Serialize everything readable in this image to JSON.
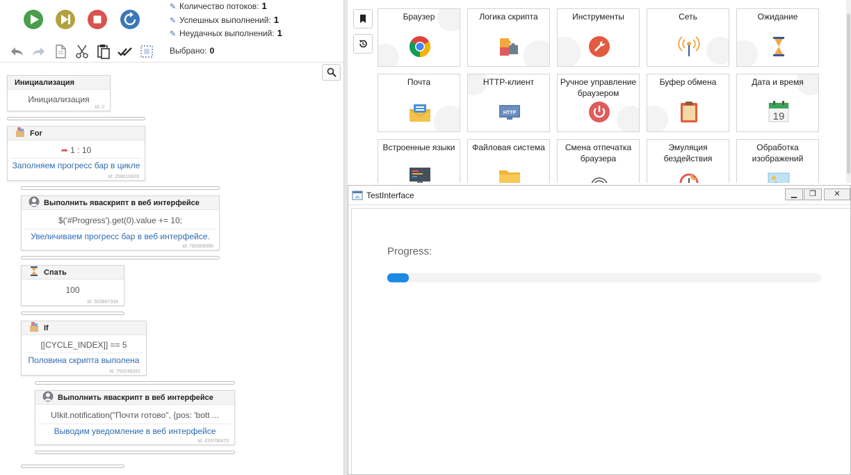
{
  "stats": {
    "threads_label": "Количество потоков:",
    "threads_value": "1",
    "success_label": "Успешных выполнений:",
    "success_value": "1",
    "fail_label": "Неудачных выполнений:",
    "fail_value": "1"
  },
  "toolbar": {
    "selected_label": "Выбрано:",
    "selected_value": "0"
  },
  "blocks": [
    {
      "title": "Инициализация",
      "body": "Инициализация",
      "comment": "",
      "id": "Id: 0"
    },
    {
      "title": "For",
      "body": "1 : 10",
      "comment": "Заполняем прогресс бар в цикле",
      "id": "Id: 259616603"
    },
    {
      "title": "Выполнить яваскрипт в веб интерфейсе",
      "body": "$('#Progress').get(0).value += 10;",
      "comment": "Увеличиваем прогресс бар в веб интерфейсе.",
      "id": "Id: 785309586"
    },
    {
      "title": "Спать",
      "body": "100",
      "comment": "",
      "id": "Id: 503697334"
    },
    {
      "title": "If",
      "body": "[[CYCLE_INDEX]] == 5",
      "comment": "Половина скрипта выполена",
      "id": "Id: 750248281"
    },
    {
      "title": "Выполнить яваскрипт в веб интерфейсе",
      "body": "UIkit.notification(\"Почти готово\", {pos: 'bott ...",
      "comment": "Выводим уведомление в веб интерфейсе",
      "id": "Id: 433706470"
    }
  ],
  "palette": [
    {
      "label": "Браузер",
      "icon": "chrome-icon"
    },
    {
      "label": "Логика скрипта",
      "icon": "puzzle-icon"
    },
    {
      "label": "Инструменты",
      "icon": "wrench-icon"
    },
    {
      "label": "Сеть",
      "icon": "antenna-icon"
    },
    {
      "label": "Ожидание",
      "icon": "hourglass-icon"
    },
    {
      "label": "Почта",
      "icon": "mail-icon"
    },
    {
      "label": "HTTP-клиент",
      "icon": "http-icon"
    },
    {
      "label": "Ручное управление браузером",
      "icon": "power-icon"
    },
    {
      "label": "Буфер обмена",
      "icon": "clipboard-icon"
    },
    {
      "label": "Дата и время",
      "icon": "calendar-icon"
    },
    {
      "label": "Встроенные языки",
      "icon": "code-monitor-icon"
    },
    {
      "label": "Файловая система",
      "icon": "folder-icon"
    },
    {
      "label": "Смена отпечатка браузера",
      "icon": "fingerprint-icon"
    },
    {
      "label": "Эмуляция бездействия",
      "icon": "alarm-icon"
    },
    {
      "label": "Обработка изображений",
      "icon": "image-icon"
    }
  ],
  "calendar_day": "19",
  "http_text": "HTTP",
  "window": {
    "title": "TestInterface",
    "progress_label": "Progress:",
    "progress_value": 0.05
  },
  "colors": {
    "play": "#4a9d4a",
    "skip": "#b2a23f",
    "stop": "#d9534f",
    "refresh": "#3a78b8",
    "comment": "#2d6bb3",
    "progress": "#1e88e5"
  }
}
